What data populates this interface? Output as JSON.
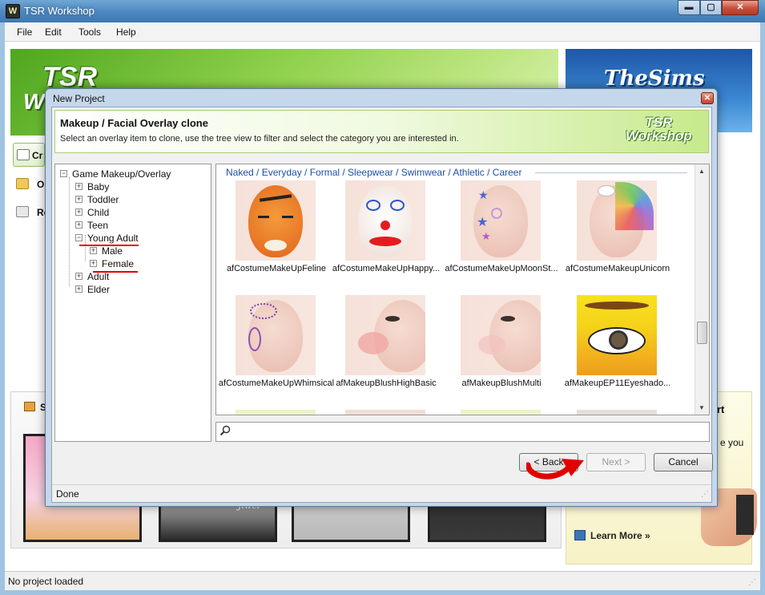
{
  "window": {
    "title": "TSR Workshop",
    "logo_letter": "W",
    "minimize_glyph": "▬",
    "maximize_glyph": "▢",
    "close_glyph": "✕"
  },
  "menu": [
    "File",
    "Edit",
    "Tools",
    "Help"
  ],
  "background": {
    "logo_text": "TSR",
    "logo_text_2": "W",
    "sims_logo": "TheSims",
    "sidebar_items": [
      "Cr",
      "Op",
      "Re"
    ],
    "panel_heading_left": "Sl",
    "panel_heading_right": "rt",
    "right_text": "e you",
    "learn_more": "Learn More »",
    "thumb_caption": "Jiwel"
  },
  "status": "No project loaded",
  "dialog": {
    "title": "New Project",
    "close_glyph": "✕",
    "header_title": "Makeup / Facial Overlay clone",
    "header_subtitle": "Select an overlay item to clone, use the tree view to filter and select the category you are interested in.",
    "header_logo_line1": "TSR",
    "header_logo_line2": "Workshop",
    "tree": {
      "root": "Game Makeup/Overlay",
      "items": [
        "Baby",
        "Toddler",
        "Child",
        "Teen",
        "Young Adult",
        "Male",
        "Female",
        "Adult",
        "Elder"
      ]
    },
    "category_filter": "Naked / Everyday / Formal / Sleepwear / Swimwear / Athletic / Career",
    "items": [
      "afCostumeMakeUpFeline",
      "afCostumeMakeUpHappy...",
      "afCostumeMakeUpMoonSt...",
      "afCostumeMakeupUnicorn",
      "afCostumeMakeUpWhimsical",
      "afMakeupBlushHighBasic",
      "afMakeupBlushMulti",
      "afMakeupEP11Eyeshado..."
    ],
    "search_value": "",
    "buttons": {
      "back": "< Back",
      "next": "Next >",
      "cancel": "Cancel"
    },
    "status": "Done"
  },
  "colors": {
    "annotation_red": "#e00000",
    "header_green": "#c7ea8c",
    "category_blue": "#1d4fa5"
  }
}
